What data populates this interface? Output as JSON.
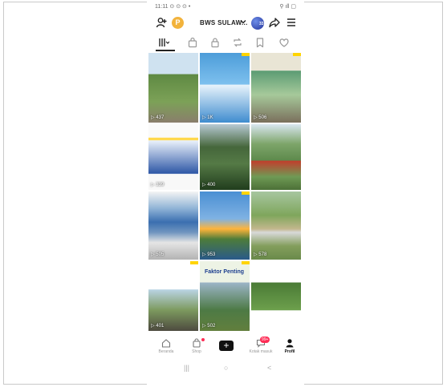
{
  "status": {
    "left": "11:11 ⊙ ⊙ ⊙ •",
    "right": "⚲ ıll ▢"
  },
  "header": {
    "points_badge": "P",
    "username": "BWS SULAW...",
    "avatar_text": "33"
  },
  "tabs": [
    {
      "icon": "grid-icon"
    },
    {
      "icon": "shop-bag-icon"
    },
    {
      "icon": "lock-icon"
    },
    {
      "icon": "repost-icon"
    },
    {
      "icon": "bookmark-icon"
    },
    {
      "icon": "heart-icon"
    }
  ],
  "videos": [
    {
      "views": "▷ 437",
      "tag": ""
    },
    {
      "views": "▷ 1K",
      "tag": ""
    },
    {
      "views": "▷ 506",
      "tag": ""
    },
    {
      "views": "▷ 339",
      "tag": ""
    },
    {
      "views": "▷ 400",
      "tag": ""
    },
    {
      "views": "",
      "tag": ""
    },
    {
      "views": "▷ 505",
      "tag": ""
    },
    {
      "views": "▷ 953",
      "tag": ""
    },
    {
      "views": "▷ 578",
      "tag": ""
    },
    {
      "views": "▷ 401",
      "tag": ""
    },
    {
      "views": "▷ 502",
      "tag": "Faktor Penting"
    },
    {
      "views": "",
      "tag": ""
    }
  ],
  "nav": {
    "home": "Beranda",
    "shop": "Shop",
    "inbox": "Kotak masuk",
    "inbox_count": "99+",
    "profile": "Profil"
  },
  "system_nav": {
    "menu": "|||",
    "home": "○",
    "back": "<"
  }
}
